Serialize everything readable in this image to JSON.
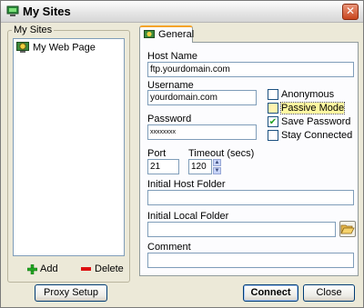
{
  "window": {
    "title": "My Sites",
    "close_glyph": "✕"
  },
  "sites": {
    "group_label": "My Sites",
    "items": [
      {
        "label": "My Web Page"
      }
    ],
    "add_label": "Add",
    "delete_label": "Delete"
  },
  "tabs": [
    {
      "label": "General",
      "selected": true
    }
  ],
  "general": {
    "host_name_label": "Host Name",
    "host_name_value": "ftp.yourdomain.com",
    "username_label": "Username",
    "username_value": "yourdomain.com",
    "password_label": "Password",
    "password_value": "xxxxxxxx",
    "port_label": "Port",
    "port_value": "21",
    "timeout_label": "Timeout (secs)",
    "timeout_value": "120",
    "initial_host_folder_label": "Initial Host Folder",
    "initial_host_folder_value": "",
    "initial_local_folder_label": "Initial Local Folder",
    "initial_local_folder_value": "",
    "comment_label": "Comment",
    "comment_value": ""
  },
  "options": {
    "anonymous": {
      "label": "Anonymous",
      "checked": false
    },
    "passive_mode": {
      "label": "Passive Mode",
      "checked": false,
      "focused": true
    },
    "save_password": {
      "label": "Save Password",
      "checked": true
    },
    "stay_connected": {
      "label": "Stay Connected",
      "checked": false
    }
  },
  "buttons": {
    "proxy_setup": "Proxy Setup",
    "connect": "Connect",
    "close": "Close"
  },
  "colors": {
    "accent_tab": "#f5a42a",
    "focus_highlight": "#fff8a0",
    "delete_red": "#dd1111",
    "add_green": "#22aa22"
  },
  "icons": [
    "site-icon",
    "close-icon",
    "globe-icon",
    "plus-icon",
    "minus-icon",
    "folder-open-icon",
    "spin-up-icon",
    "spin-down-icon"
  ]
}
